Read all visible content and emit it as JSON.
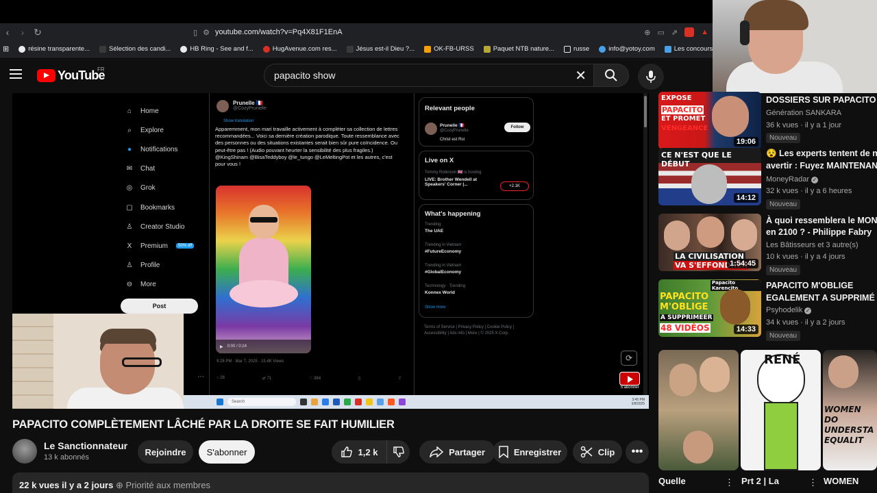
{
  "browser": {
    "url": "youtube.com/watch?v=Pq4X81F1EnA",
    "bookmarks": [
      {
        "label": "résine transparente...",
        "color": "#e8eaed"
      },
      {
        "label": "Sélection des candi...",
        "color": "#e8eaed"
      },
      {
        "label": "HB Ring - See and f...",
        "color": "#e8eaed"
      },
      {
        "label": "HugAvenue.com res...",
        "color": "#d93025"
      },
      {
        "label": "Jésus est-il Dieu ?...",
        "color": "#e8eaed"
      },
      {
        "label": "OK-FB-URSS",
        "color": "#f4a000"
      },
      {
        "label": "Paquet NTB nature...",
        "color": "#e8eaed"
      },
      {
        "label": "russe",
        "color": "#e8eaed"
      },
      {
        "label": "info@yotoy.com",
        "color": "#4aa0e6"
      },
      {
        "label": "Les concours d'aute...",
        "color": "#e8eaed"
      },
      {
        "label": "yo",
        "color": "#e8eaed"
      }
    ]
  },
  "youtube": {
    "logo": "YouTube",
    "region": "FR",
    "search_query": "papacito show"
  },
  "video_content": {
    "x_nav": [
      "Home",
      "Explore",
      "Notifications",
      "Chat",
      "Grok",
      "Bookmarks",
      "Creator Studio",
      "Premium",
      "Profile",
      "More"
    ],
    "x_nav_icons": [
      "⌂",
      "⌕",
      "●",
      "✉",
      "◎",
      "▢",
      "♙",
      "X",
      "♙",
      "⊖"
    ],
    "premium_badge": "50% off",
    "post_btn": "Post",
    "tweet_author": "Prunelle 🇫🇷",
    "tweet_handle": "@CozyPrunelle",
    "tweet_translate": "Show translation",
    "tweet_text": "Apparemment, mon mari travaille activement à compléter sa collection de lettres recommandées... Voici sa dernière création parodique. Toute ressemblance avec des personnes ou des situations existantes serait bien sûr pure coïncidence. Ou peut-être pas ! (Audio pouvant heurter la sensibilité des plus fragiles.) @KingShinam @BisaTeddyboy @le_tungo @LeMeltingPot et les autres, c'est pour vous !",
    "tweet_time": "0:00 / 0:24",
    "tweet_date": "9:28 PM · Mar 7, 2025 · 15.4K Views",
    "tweet_actions": [
      "26",
      "71",
      "384",
      "",
      ""
    ],
    "relevant_title": "Relevant people",
    "relevant_name": "Prunelle 🇫🇷",
    "relevant_handle": "@CozyPrunelle",
    "relevant_bio": "Christ est Roi",
    "follow": "Follow",
    "live_title": "Live on X",
    "live_host": "Tommy Robinson 🇬🇧 is hosting",
    "live_text": "LIVE: Brother Wendell at Speakers' Corner |...",
    "live_count": "+2.1K",
    "happening_title": "What's happening",
    "trends": [
      {
        "label": "Trending",
        "name": "The UAE"
      },
      {
        "label": "Trending in Vietnam",
        "name": "#FutureEconomy"
      },
      {
        "label": "Trending in Vietnam",
        "name": "#GlobalEconomy"
      },
      {
        "label": "Technology · Trending",
        "name": "Konnex World"
      }
    ],
    "show_more": "Show more",
    "footer": "Terms of Service | Privacy Policy | Cookie Policy | Accessibility | Ads info | More | © 2025 X Corp.",
    "taskbar_search": "Search",
    "taskbar_time": "3:45 PM\n3/8/2025",
    "subscribe_overlay": "S'abonner"
  },
  "video": {
    "title": "PAPACITO COMPLÈTEMENT LÂCHÉ PAR LA DROITE SE FAIT HUMILIER",
    "channel": "Le Sanctionnateur",
    "subs": "13 k abonnés",
    "join": "Rejoindre",
    "subscribe": "S'abonner",
    "likes": "1,2 k",
    "share": "Partager",
    "save": "Enregistrer",
    "clip": "Clip",
    "desc_views": "22 k vues  il y a 2 jours",
    "desc_priority": "Priorité aux membres"
  },
  "recommendations": [
    {
      "title": "DOSSIERS SUR PAPACITO et",
      "title2": "",
      "channel": "Génération SANKARA",
      "meta": "36 k vues · il y a 1 jour",
      "badge": "Nouveau",
      "duration": "19:06",
      "verified": false
    },
    {
      "title": "😵 Les experts tentent de nous",
      "title2": "avertir : Fuyez MAINTENANT",
      "channel": "MoneyRadar",
      "meta": "32 k vues · il y a 6 heures",
      "badge": "Nouveau",
      "duration": "14:12",
      "verified": true
    },
    {
      "title": "À quoi ressemblera le MONDE",
      "title2": "en 2100 ? - Philippe Fabry",
      "channel": "Les Bâtisseurs et 3 autre(s)",
      "meta": "10 k vues · il y a 4 jours",
      "badge": "Nouveau",
      "duration": "1:54:45",
      "verified": false
    },
    {
      "title": "PAPACITO M'OBLIGE",
      "title2": "EGALEMENT A SUPPRIMÉ ...",
      "channel": "Psyhodelik",
      "meta": "34 k vues · il y a 2 jours",
      "badge": "Nouveau",
      "duration": "14:33",
      "verified": true
    }
  ],
  "thumb_texts": {
    "t1a": "EXPOSE",
    "t1b": "PAPACITO",
    "t1c": "ET PROMET",
    "t1d": "VENGEANCE",
    "t2": "CE N'EST QUE LE DÉBUT",
    "t3a": "LA CIVILISATION",
    "t3b": "VA S'EFFONDRER",
    "t4a": "PAPACITO",
    "t4b": "M'OBLIGE",
    "t4c": "A SUPPRIMEER",
    "t4d": "48 VIDÉOS",
    "t4e": "Papacito Karencito"
  },
  "shorts": [
    {
      "title": "Quelle",
      "thumb_text": ""
    },
    {
      "title": "Prt 2 | La",
      "thumb_text": "RENÉ"
    },
    {
      "title": "WOMEN",
      "thumb_text": "WOMEN DO UNDERSTA EQUALIT"
    }
  ]
}
